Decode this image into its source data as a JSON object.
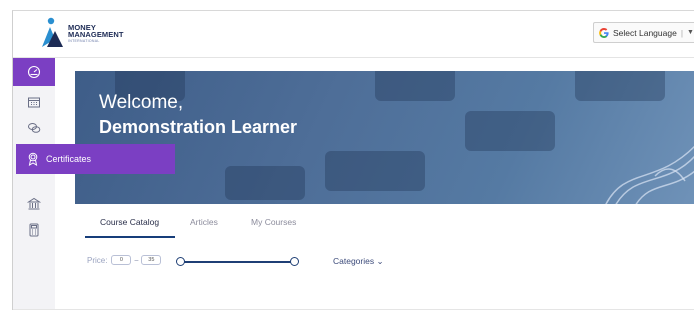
{
  "header": {
    "brand_line1": "MONEY",
    "brand_line2": "MANAGEMENT",
    "brand_sub": "INTERNATIONAL",
    "language_label": "Select Language",
    "language_arrow": "▼"
  },
  "sidebar": {
    "items": [
      {
        "icon": "dashboard-gauge-icon",
        "active": true
      },
      {
        "icon": "calendar-icon",
        "active": false
      },
      {
        "icon": "chat-bubbles-icon",
        "active": false
      },
      {
        "icon": "certificate-award-icon",
        "active": false,
        "label": "Certificates"
      },
      {
        "icon": "bank-icon",
        "active": false
      },
      {
        "icon": "calculator-icon",
        "active": false
      }
    ],
    "flyout_label": "Certificates",
    "accent_color": "#7b3fc3"
  },
  "hero": {
    "welcome": "Welcome,",
    "name": "Demonstration Learner"
  },
  "tabs": [
    {
      "label": "Course Catalog",
      "active": true
    },
    {
      "label": "Articles",
      "active": false
    },
    {
      "label": "My Courses",
      "active": false
    }
  ],
  "filters": {
    "price_label": "Price:",
    "price_min": "0",
    "price_max": "35",
    "price_sep": "–",
    "slider_low_fraction": 0,
    "slider_high_fraction": 1,
    "categories_label": "Categories ⌄"
  }
}
